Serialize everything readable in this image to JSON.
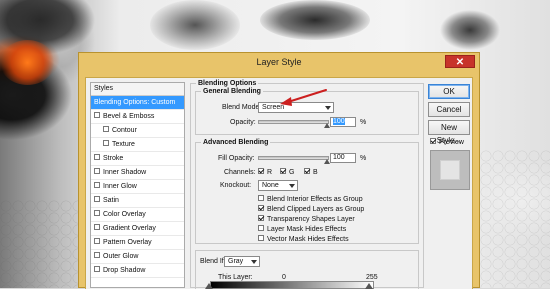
{
  "dialog": {
    "title": "Layer Style",
    "close_label": "✕"
  },
  "styles_panel": {
    "header": "Styles",
    "items": [
      {
        "label": "Blending Options: Custom",
        "checkbox": false,
        "checked": false,
        "indent": 0,
        "selected": true
      },
      {
        "label": "Bevel & Emboss",
        "checkbox": true,
        "checked": false,
        "indent": 0,
        "selected": false
      },
      {
        "label": "Contour",
        "checkbox": true,
        "checked": false,
        "indent": 1,
        "selected": false
      },
      {
        "label": "Texture",
        "checkbox": true,
        "checked": false,
        "indent": 1,
        "selected": false
      },
      {
        "label": "Stroke",
        "checkbox": true,
        "checked": false,
        "indent": 0,
        "selected": false
      },
      {
        "label": "Inner Shadow",
        "checkbox": true,
        "checked": false,
        "indent": 0,
        "selected": false
      },
      {
        "label": "Inner Glow",
        "checkbox": true,
        "checked": false,
        "indent": 0,
        "selected": false
      },
      {
        "label": "Satin",
        "checkbox": true,
        "checked": false,
        "indent": 0,
        "selected": false
      },
      {
        "label": "Color Overlay",
        "checkbox": true,
        "checked": false,
        "indent": 0,
        "selected": false
      },
      {
        "label": "Gradient Overlay",
        "checkbox": true,
        "checked": false,
        "indent": 0,
        "selected": false
      },
      {
        "label": "Pattern Overlay",
        "checkbox": true,
        "checked": false,
        "indent": 0,
        "selected": false
      },
      {
        "label": "Outer Glow",
        "checkbox": true,
        "checked": false,
        "indent": 0,
        "selected": false
      },
      {
        "label": "Drop Shadow",
        "checkbox": true,
        "checked": false,
        "indent": 0,
        "selected": false
      }
    ]
  },
  "blending_options": {
    "title": "Blending Options",
    "general": {
      "title": "General Blending",
      "blend_mode_label": "Blend Mode:",
      "blend_mode_value": "Screen",
      "opacity_label": "Opacity:",
      "opacity_value": "100",
      "opacity_unit": "%",
      "opacity_level": 1.0
    },
    "advanced": {
      "title": "Advanced Blending",
      "fill_opacity_label": "Fill Opacity:",
      "fill_opacity_value": "100",
      "fill_opacity_unit": "%",
      "fill_opacity_level": 1.0,
      "channels_label": "Channels:",
      "channel_r": "R",
      "channel_g": "G",
      "channel_b": "B",
      "knockout_label": "Knockout:",
      "knockout_value": "None",
      "options": [
        {
          "label": "Blend Interior Effects as Group",
          "checked": false
        },
        {
          "label": "Blend Clipped Layers as Group",
          "checked": true
        },
        {
          "label": "Transparency Shapes Layer",
          "checked": true
        },
        {
          "label": "Layer Mask Hides Effects",
          "checked": false
        },
        {
          "label": "Vector Mask Hides Effects",
          "checked": false
        }
      ]
    },
    "blend_if": {
      "label": "Blend If:",
      "value": "Gray",
      "this_layer_label": "This Layer:",
      "low": "0",
      "high": "255"
    }
  },
  "buttons": {
    "ok": "OK",
    "cancel": "Cancel",
    "new_style": "New Style...",
    "preview": "Preview",
    "preview_checked": true
  },
  "colors": {
    "dialog_frame": "#e8c46a",
    "selection": "#3399ff",
    "arrow": "#cc1f1f",
    "close_button": "#c7332a"
  }
}
